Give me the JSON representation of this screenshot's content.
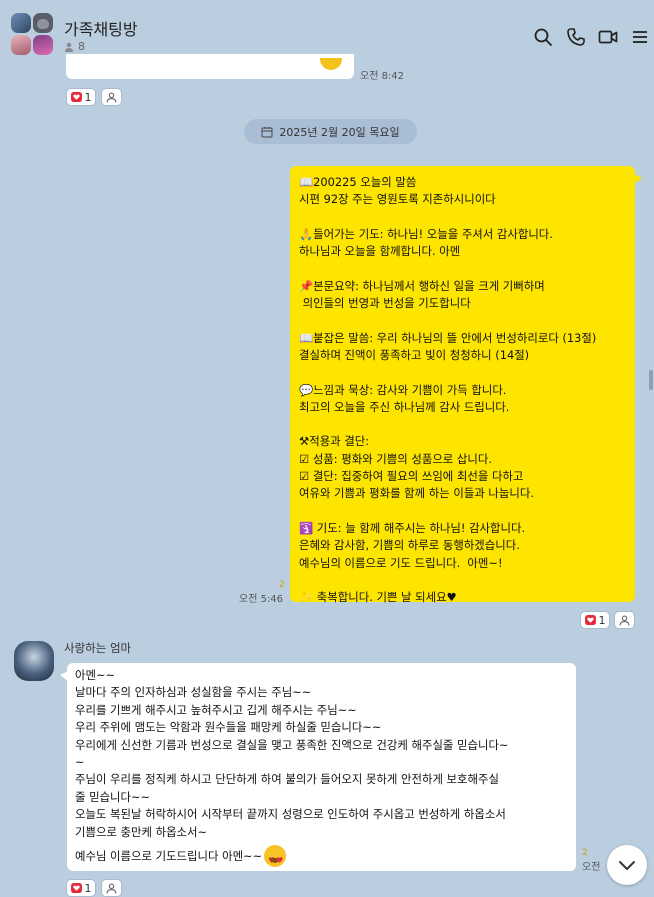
{
  "header": {
    "title": "가족채팅방",
    "member_count": "8"
  },
  "top_message": {
    "time": "오전 8:42",
    "reaction_count": "1"
  },
  "date_divider": "2025년 2월 20일 목요일",
  "my_message": {
    "lines": [
      "📖200225 오늘의 말씀",
      "시편 92장 주는 영원토록 지존하시니이다",
      "",
      "🙏들어가는 기도: 하나님! 오늘을 주셔서 감사합니다.",
      "하나님과 오늘을 함께합니다. 아멘",
      "",
      "📌본문요약: 하나님께서 행하신 일을 크게 기뻐하며",
      " 의인들의 번영과 번성을 기도합니다",
      "",
      "📖붙잡은 말씀: 우리 하나님의 뜰 안에서 번성하리로다 (13절)",
      "결실하며 진액이 풍족하고 빛이 청청하니 (14절)",
      "",
      "💬느낌과 묵상: 감사와 기쁨이 가득 합니다.",
      "최고의 오늘을 주신 하나님께 감사 드립니다.",
      "",
      "⚒적용과 결단:",
      "☑ 성품: 평화와 기쁨의 성품으로 삽니다.",
      "☑ 결단: 집중하여 필요의 쓰임에 최선을 다하고",
      "여유와 기쁨과 평화를 함께 하는 이들과 나눕니다.",
      "",
      "🛐 기도: 늘 함께 해주시는 하나님! 감사합니다.",
      "은혜와 감사함, 기쁨의 하루로 동행하겠습니다.",
      "예수님의 이름으로 기도 드립니다.  아멘~!",
      "",
      "✨ 축복합니다. 기쁜 날 되세요♥"
    ],
    "time": "오전 5:46",
    "unread": "2",
    "reaction_count": "1"
  },
  "reply": {
    "sender": "사랑하는 엄마",
    "lines": [
      "아멘~~",
      "날마다 주의 인자하심과 성실함을 주시는 주님~~",
      "우리를 기쁘게 해주시고 높혀주시고 깁게 해주시는 주님~~",
      "우리 주위에 맴도는 악함과 원수들을 패망케 하실줄 믿습니다~~",
      "우리에게 신선한 기름과 번성으로 결실을 맺고 풍족한 진액으로 건강케 해주실줄 믿습니다~",
      "~",
      "주님이 우리를 정직케 하시고 단단하게 하여 불의가 들어오지 못하게 안전하게 보호해주실",
      "줄 믿습니다~~",
      "오늘도 복된날 허락하시어 시작부터 끝까지 성령으로 인도하여 주시옵고 번성하게 하옵소서",
      "기쁨으로 충만케 하옵소서~"
    ],
    "last_line": "예수님 이름으로 기도드립니다 아멘~~",
    "time": "오전",
    "unread": "2",
    "reaction_count": "1"
  },
  "icons": [
    "search-icon",
    "phone-icon",
    "video-icon",
    "menu-icon",
    "person-icon",
    "heart-icon",
    "calendar-icon",
    "chevron-down-icon"
  ],
  "colors": {
    "background": "#bacee0",
    "my_bubble": "#fee500",
    "other_bubble": "#ffffff",
    "heart": "#e5293b"
  }
}
